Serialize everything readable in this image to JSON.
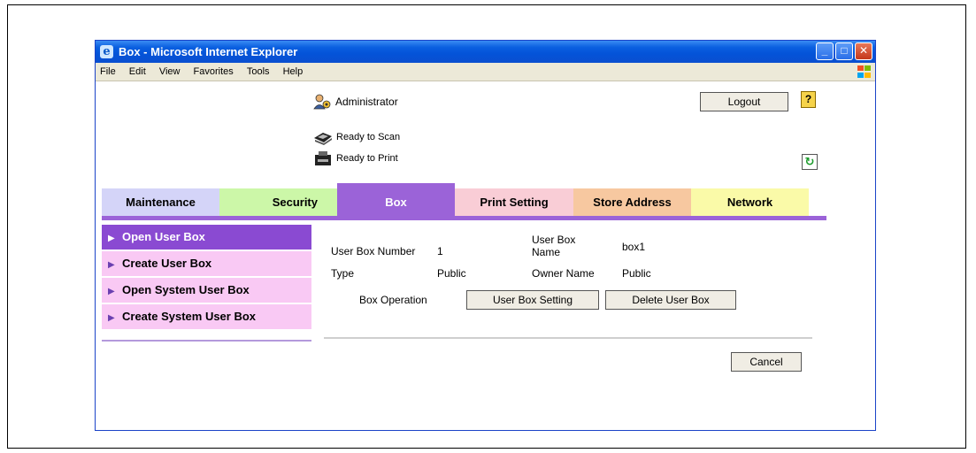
{
  "window": {
    "title": "Box - Microsoft Internet Explorer",
    "menu": [
      "File",
      "Edit",
      "View",
      "Favorites",
      "Tools",
      "Help"
    ]
  },
  "header": {
    "user": "Administrator",
    "logout_label": "Logout",
    "help_label": "?",
    "scan_status": "Ready to Scan",
    "print_status": "Ready to Print"
  },
  "tabs": [
    {
      "label": "Maintenance",
      "color": "#d4d4f8"
    },
    {
      "label": "Security",
      "color": "#ccf7a8"
    },
    {
      "label": "Box",
      "color": "#9b63d8"
    },
    {
      "label": "Print Setting",
      "color": "#f9cdd6"
    },
    {
      "label": "Store Address",
      "color": "#f7c8a0"
    },
    {
      "label": "Network",
      "color": "#fafaa8"
    }
  ],
  "sidebar": {
    "items": [
      {
        "label": "Open User Box"
      },
      {
        "label": "Create User Box"
      },
      {
        "label": "Open System User Box"
      },
      {
        "label": "Create System User Box"
      }
    ]
  },
  "detail": {
    "box_number_label": "User Box Number",
    "box_number_value": "1",
    "box_name_label_1": "User Box",
    "box_name_label_2": "Name",
    "box_name_value": "box1",
    "type_label": "Type",
    "type_value": "Public",
    "owner_label": "Owner Name",
    "owner_value": "Public",
    "operation_label": "Box Operation",
    "setting_button": "User Box Setting",
    "delete_button": "Delete User Box",
    "cancel_button": "Cancel"
  }
}
